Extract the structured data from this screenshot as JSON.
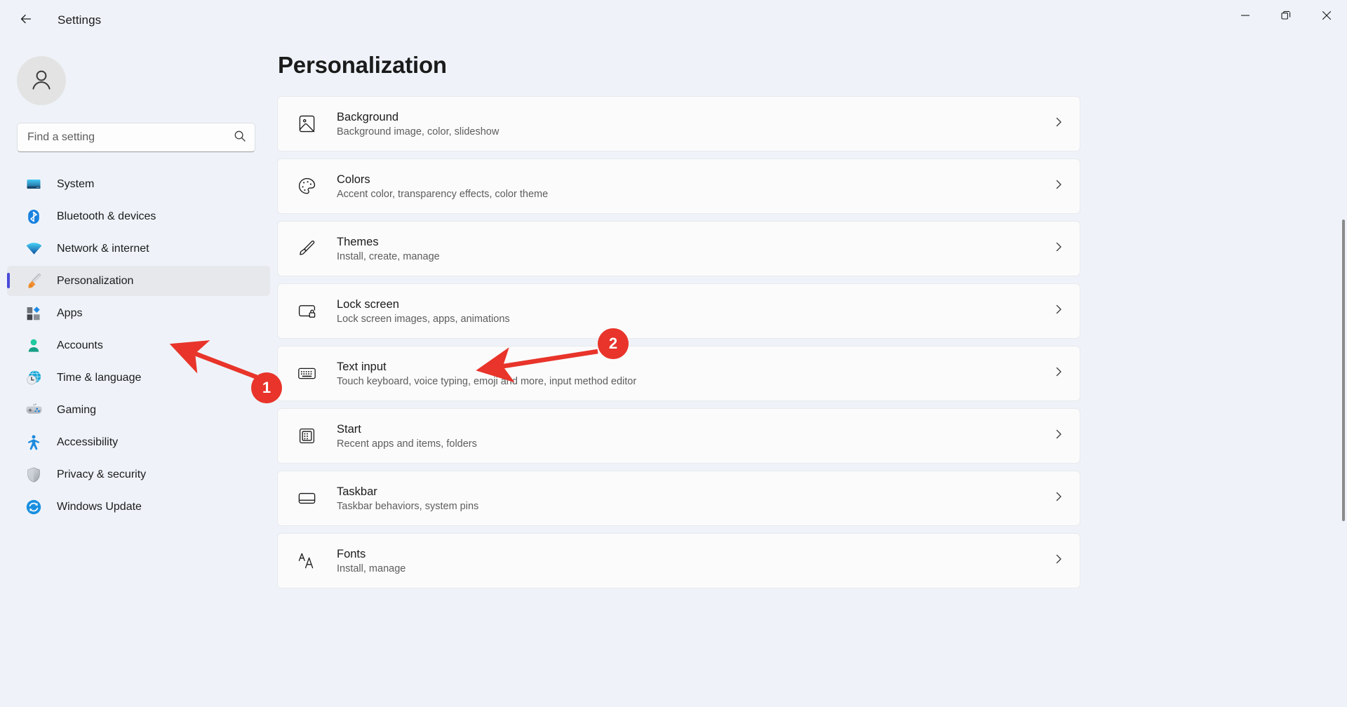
{
  "window": {
    "app_title": "Settings",
    "back_icon": "back-arrow-icon",
    "minimize_label": "Minimize",
    "restore_label": "Restore",
    "close_label": "Close"
  },
  "sidebar": {
    "avatar_icon": "user-avatar-icon",
    "search": {
      "placeholder": "Find a setting",
      "value": "",
      "icon": "search-icon"
    },
    "items": [
      {
        "label": "System",
        "icon": "system-monitor-icon",
        "active": false
      },
      {
        "label": "Bluetooth & devices",
        "icon": "bluetooth-icon",
        "active": false
      },
      {
        "label": "Network & internet",
        "icon": "wifi-icon",
        "active": false
      },
      {
        "label": "Personalization",
        "icon": "paintbrush-icon",
        "active": true
      },
      {
        "label": "Apps",
        "icon": "apps-blocks-icon",
        "active": false
      },
      {
        "label": "Accounts",
        "icon": "account-person-icon",
        "active": false
      },
      {
        "label": "Time & language",
        "icon": "clock-globe-icon",
        "active": false
      },
      {
        "label": "Gaming",
        "icon": "gamepad-icon",
        "active": false
      },
      {
        "label": "Accessibility",
        "icon": "accessibility-person-icon",
        "active": false
      },
      {
        "label": "Privacy & security",
        "icon": "shield-icon",
        "active": false
      },
      {
        "label": "Windows Update",
        "icon": "update-refresh-icon",
        "active": false
      }
    ]
  },
  "main": {
    "page_title": "Personalization",
    "cards": [
      {
        "title": "Background",
        "subtitle": "Background image, color, slideshow",
        "icon": "picture-icon"
      },
      {
        "title": "Colors",
        "subtitle": "Accent color, transparency effects, color theme",
        "icon": "palette-icon"
      },
      {
        "title": "Themes",
        "subtitle": "Install, create, manage",
        "icon": "paintbrush-outline-icon"
      },
      {
        "title": "Lock screen",
        "subtitle": "Lock screen images, apps, animations",
        "icon": "lock-screen-icon"
      },
      {
        "title": "Text input",
        "subtitle": "Touch keyboard, voice typing, emoji and more, input method editor",
        "icon": "keyboard-icon"
      },
      {
        "title": "Start",
        "subtitle": "Recent apps and items, folders",
        "icon": "start-menu-icon"
      },
      {
        "title": "Taskbar",
        "subtitle": "Taskbar behaviors, system pins",
        "icon": "taskbar-icon"
      },
      {
        "title": "Fonts",
        "subtitle": "Install, manage",
        "icon": "fonts-aa-icon"
      }
    ],
    "chevron_icon": "chevron-right-icon"
  },
  "annotations": {
    "color": "#e8342a",
    "steps": [
      {
        "number": "1",
        "target": "Personalization"
      },
      {
        "number": "2",
        "target": "Lock screen"
      }
    ]
  }
}
